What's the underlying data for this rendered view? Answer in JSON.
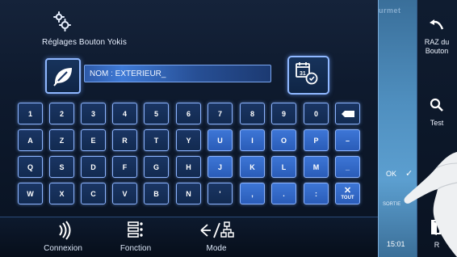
{
  "header": {
    "title": "Réglages Bouton Yokis",
    "icon": "gears-icon"
  },
  "name_field": {
    "value": "NOM : EXTERIEUR_"
  },
  "keyboard": {
    "rows": [
      [
        "1",
        "2",
        "3",
        "4",
        "5",
        "6",
        "7",
        "8",
        "9",
        "0",
        "←"
      ],
      [
        "A",
        "Z",
        "E",
        "R",
        "T",
        "Y",
        "U",
        "I",
        "O",
        "P",
        "–"
      ],
      [
        "Q",
        "S",
        "D",
        "F",
        "G",
        "H",
        "J",
        "K",
        "L",
        "M",
        "_"
      ],
      [
        "W",
        "X",
        "C",
        "V",
        "B",
        "N",
        "'",
        ",",
        ".",
        ":",
        "TOUT"
      ]
    ],
    "clear_all_label": "TOUT"
  },
  "right_panel": {
    "brand": "urmet",
    "ok_label": "OK",
    "exit_label": "SORTIE",
    "time": "15:01"
  },
  "side_buttons": {
    "reset_label_line1": "RAZ du",
    "reset_label_line2": "Bouton",
    "test_label": "Test",
    "exit_label": "R"
  },
  "bottom_nav": [
    {
      "label": "Connexion",
      "icon": "wireless-signal-icon"
    },
    {
      "label": "Fonction",
      "icon": "function-list-icon"
    },
    {
      "label": "Mode",
      "icon": "mode-network-icon"
    }
  ],
  "colors": {
    "key_border": "#8db4ff",
    "key_fill": "#122a50",
    "key_highlight": "#3d76d6",
    "panel_blue": "#4f8fbf"
  }
}
